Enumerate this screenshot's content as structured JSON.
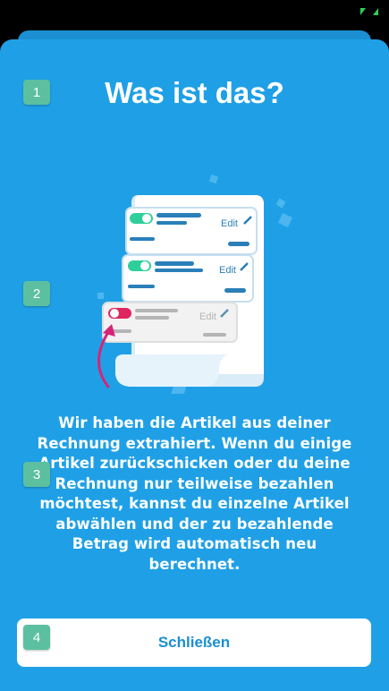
{
  "colors": {
    "background": "#1fa0e6",
    "badge": "#5cc0a0",
    "button_text": "#1b8fd1",
    "toggle_on": "#2ecf9a",
    "toggle_off": "#e0245e"
  },
  "status_bar": {
    "icon": "expand-icon"
  },
  "badges": [
    "1",
    "2",
    "3",
    "4"
  ],
  "title": "Was ist das?",
  "illustration": {
    "items": [
      {
        "edit_label": "Edit",
        "selected": true
      },
      {
        "edit_label": "Edit",
        "selected": true
      },
      {
        "edit_label": "Edit",
        "selected": false
      }
    ]
  },
  "description": "Wir haben die Artikel aus deiner Rechnung extrahiert. Wenn du einige Artikel zurückschicken oder du deine Rechnung nur teilweise bezahlen möchtest, kannst du einzelne Artikel abwählen und der zu bezahlende Betrag wird automatisch  neu berechnet.",
  "close_button_label": "Schließen"
}
